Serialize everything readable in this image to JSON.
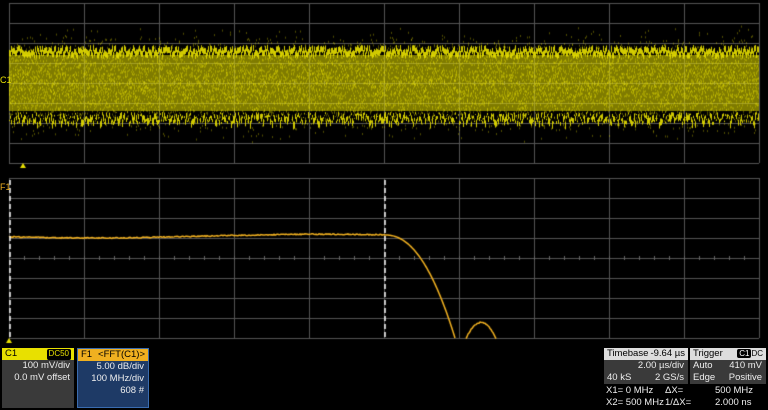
{
  "channel_c1": {
    "label": "C1",
    "coupling": "DC50",
    "vdiv": "100 mV/div",
    "offset": "0.0 mV offset",
    "marker": "C1"
  },
  "math_f1": {
    "label": "F1",
    "function": "<FFT(C1)>",
    "vdiv": "5.00 dB/div",
    "hdiv": "100 MHz/div",
    "count": "608 #",
    "marker": "F1"
  },
  "timebase": {
    "label": "Timebase",
    "delay": "-9.64 µs",
    "tdiv": "2.00 µs/div",
    "samples": "40 kS",
    "rate": "2 GS/s"
  },
  "trigger": {
    "label": "Trigger",
    "source": "C1",
    "coupling": "DC",
    "mode": "Auto",
    "level": "410 mV",
    "type": "Edge",
    "slope": "Positive"
  },
  "cursors": {
    "x1": "X1= 0 MHz",
    "dx": "ΔX=",
    "dx_val": "500 MHz",
    "x2": "X2= 500 MHz",
    "inv_dx": "1/ΔX=",
    "inv_dx_val": "2.000 ns"
  },
  "colors": {
    "c1": "#e8e000",
    "f1": "#f0b020",
    "grid": "#555555",
    "f1_panel": "#1e3a66"
  }
}
